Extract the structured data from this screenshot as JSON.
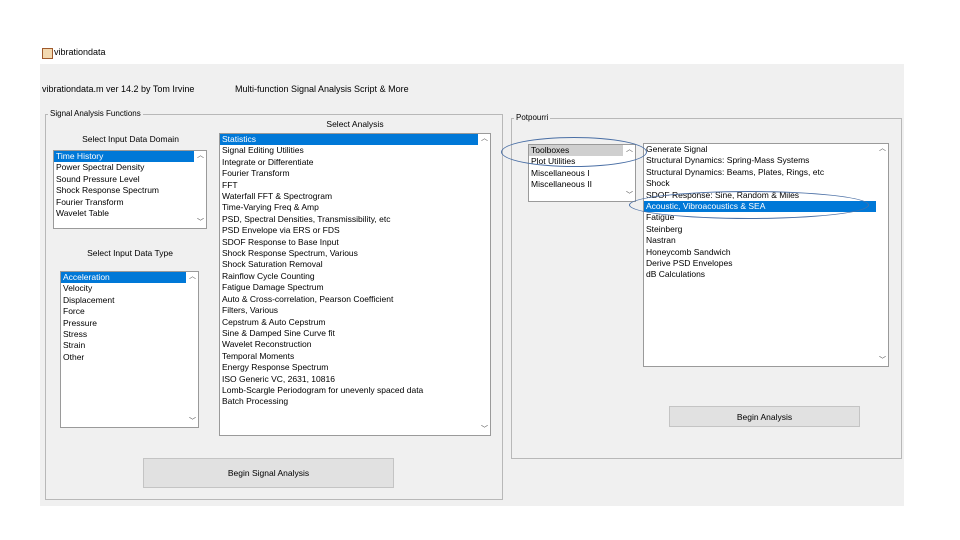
{
  "window": {
    "title": "vibrationdata"
  },
  "header": {
    "left": "vibrationdata.m  ver 14.2  by Tom Irvine",
    "right": "Multi-function Signal Analysis Script & More"
  },
  "signal_panel": {
    "title": "Signal Analysis Functions",
    "domain_label": "Select Input Data Domain",
    "domain_items": [
      "Time History",
      "Power Spectral Density",
      "Sound Pressure Level",
      "Shock Response Spectrum",
      "Fourier Transform",
      "Wavelet Table"
    ],
    "type_label": "Select Input Data Type",
    "type_items": [
      "Acceleration",
      "Velocity",
      "Displacement",
      "Force",
      "Pressure",
      "Stress",
      "Strain",
      "Other"
    ],
    "analysis_label": "Select Analysis",
    "analysis_items": [
      "Statistics",
      "Signal Editing Utilities",
      "Integrate or Differentiate",
      "Fourier Transform",
      "FFT",
      "Waterfall FFT & Spectrogram",
      "Time-Varying Freq & Amp",
      "PSD, Spectral Densities, Transmissibility, etc",
      "PSD Envelope via ERS or FDS",
      "SDOF Response to Base Input",
      "Shock Response Spectrum, Various",
      "Shock Saturation Removal",
      "Rainflow Cycle Counting",
      "Fatigue Damage Spectrum",
      "Auto & Cross-correlation, Pearson Coefficient",
      "Filters, Various",
      "Cepstrum & Auto Cepstrum",
      "Sine & Damped Sine Curve fit",
      "Wavelet Reconstruction",
      "Temporal Moments",
      "Energy Response Spectrum",
      "ISO Generic VC, 2631, 10816",
      "Lomb-Scargle Periodogram for unevenly spaced data",
      "Batch Processing"
    ],
    "begin_button": "Begin Signal Analysis"
  },
  "potpourri_panel": {
    "title": "Potpourri",
    "left_items": [
      "Toolboxes",
      "Plot Utilities",
      "Miscellaneous I",
      "Miscellaneous II"
    ],
    "right_items": [
      "Generate Signal",
      "Structural Dynamics: Spring-Mass Systems",
      "Structural Dynamics: Beams, Plates, Rings, etc",
      "Shock",
      "SDOF Response:  Sine, Random & Miles",
      "Acoustic, Vibroacoustics & SEA",
      "Fatigue",
      "Steinberg",
      "Nastran",
      "Honeycomb Sandwich",
      "Derive PSD Envelopes",
      "dB Calculations"
    ],
    "begin_button": "Begin Analysis"
  },
  "colors": {
    "selection_blue": "#0078d7",
    "selection_gray": "#cfcfcf",
    "annotation_oval": "#4a6fa5"
  }
}
